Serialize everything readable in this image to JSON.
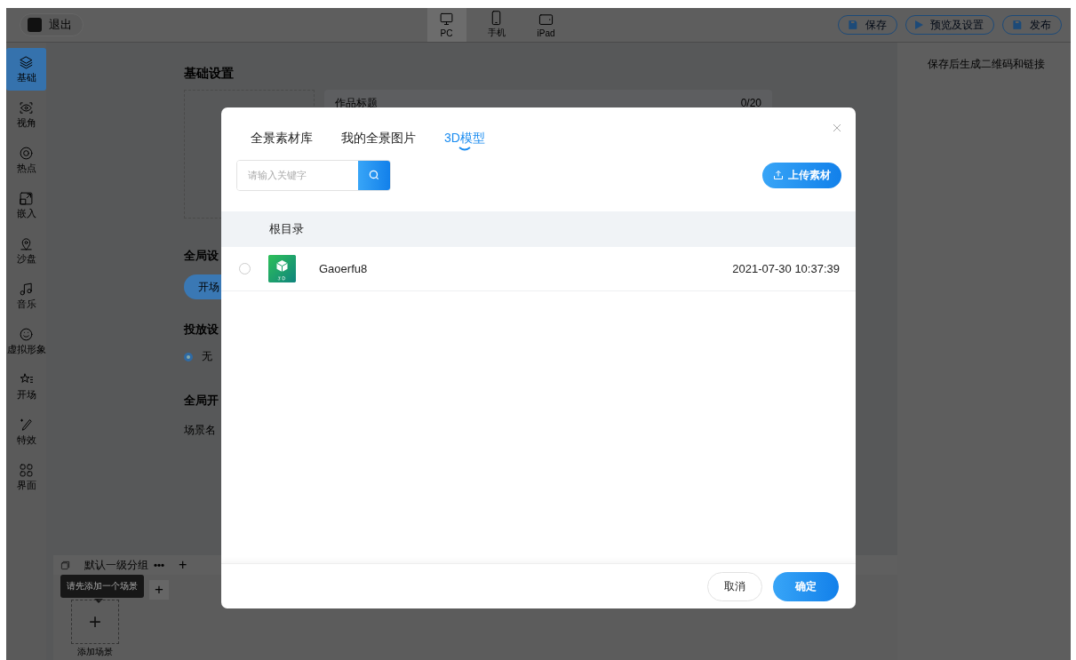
{
  "topbar": {
    "exit_label": "退出",
    "devices": [
      {
        "label": "PC",
        "selected": true
      },
      {
        "label": "手机",
        "selected": false
      },
      {
        "label": "iPad",
        "selected": false
      }
    ],
    "actions": [
      "保存",
      "预览及设置",
      "发布"
    ]
  },
  "sidebar": {
    "items": [
      {
        "label": "基础",
        "selected": true
      },
      {
        "label": "视角",
        "selected": false
      },
      {
        "label": "热点",
        "selected": false
      },
      {
        "label": "嵌入",
        "selected": false
      },
      {
        "label": "沙盘",
        "selected": false
      },
      {
        "label": "音乐",
        "selected": false
      },
      {
        "label": "虚拟形象",
        "selected": false
      },
      {
        "label": "开场",
        "selected": false
      },
      {
        "label": "特效",
        "selected": false
      },
      {
        "label": "界面",
        "selected": false
      }
    ]
  },
  "main": {
    "section_title": "基础设置",
    "title_field": {
      "placeholder": "作品标题",
      "counter": "0/20"
    },
    "global_heading": "全局设",
    "opening_button": "开场",
    "delivery_heading": "投放设",
    "delivery_options": [
      {
        "label": "无",
        "selected": true
      }
    ],
    "global_switch_heading": "全局开",
    "scene_name_label": "场景名"
  },
  "right_panel": {
    "hint": "保存后生成二维码和链接"
  },
  "scene_bar": {
    "group": "默认一级分组",
    "more": "•••",
    "add": "+",
    "tab_add": "+",
    "tooltip": "请先添加一个场景",
    "add_scene": {
      "icon": "+",
      "label": "添加场景"
    }
  },
  "dialog": {
    "tabs": [
      {
        "label": "全景素材库",
        "selected": false
      },
      {
        "label": "我的全景图片",
        "selected": false
      },
      {
        "label": "3D模型",
        "selected": true
      }
    ],
    "search": {
      "placeholder": "请输入关键字"
    },
    "upload_button": "上传素材",
    "breadcrumb": "根目录",
    "files": [
      {
        "name": "Gaoerfu8",
        "date": "2021-07-30 10:37:39",
        "selected": false
      }
    ],
    "buttons": [
      "取消",
      "确定"
    ]
  }
}
